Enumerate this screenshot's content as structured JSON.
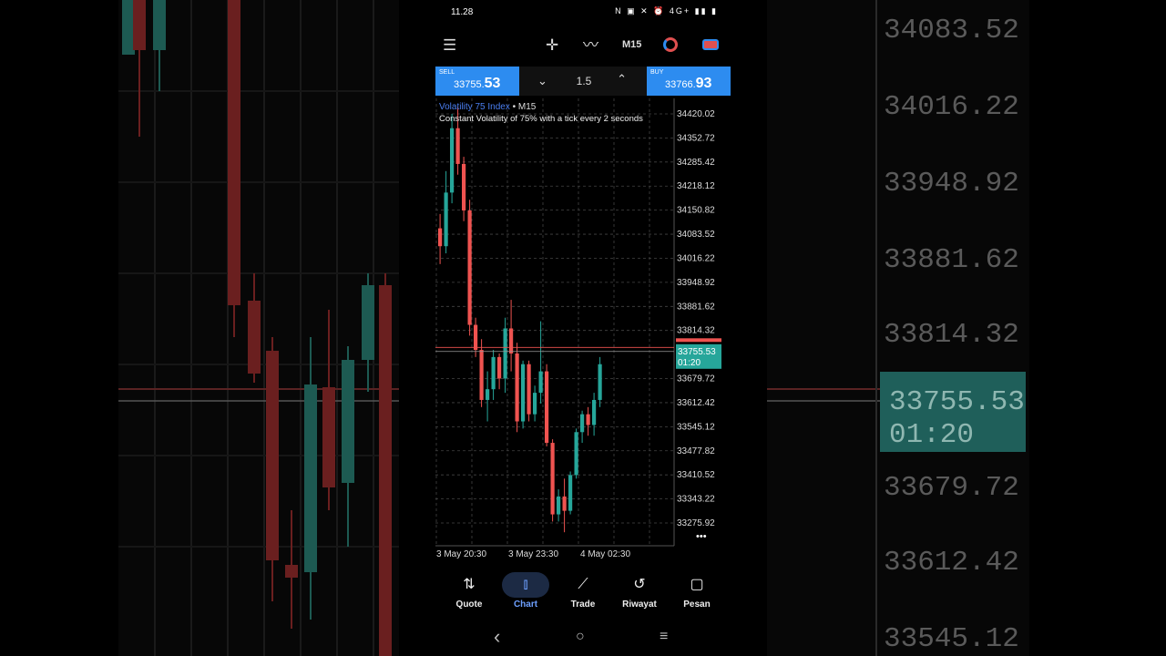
{
  "status": {
    "time": "11.28",
    "icons": "N ▣ ✕ ⏰ 4G+ ▮▮ ▮"
  },
  "toolbar": {
    "timeframe": "M15",
    "icons": [
      "menu-icon",
      "crosshair-icon",
      "indicator-icon",
      "timeframe-clock-icon",
      "toggle-icon"
    ]
  },
  "trade": {
    "sell_label": "SELL",
    "sell_price_main": "33755.",
    "sell_price_big": "53",
    "buy_label": "BUY",
    "buy_price_main": "33766.",
    "buy_price_big": "93",
    "volume": "1.5"
  },
  "chart": {
    "symbol": "Volatility 75 Index",
    "separator": " • ",
    "timeframe": "M15",
    "description": "Constant Volatility of 75% with a tick every 2 seconds",
    "current_price": "33755.53",
    "countdown": "01:20",
    "more": "•••"
  },
  "chart_data": {
    "type": "candlestick",
    "ylim": [
      33243,
      34430
    ],
    "price_ticks": [
      "34420.02",
      "34352.72",
      "34285.42",
      "34218.12",
      "34150.82",
      "34083.52",
      "34016.22",
      "33948.92",
      "33881.62",
      "33814.32",
      "33679.72",
      "33612.42",
      "33545.12",
      "33477.82",
      "33410.52",
      "33343.22",
      "33275.92"
    ],
    "time_labels": [
      "3 May 20:30",
      "3 May 23:30",
      "4 May 02:30"
    ],
    "bid": 33755.53,
    "ask": 33766.93,
    "candles": [
      {
        "o": 34100,
        "h": 34140,
        "l": 34000,
        "c": 34050
      },
      {
        "o": 34050,
        "h": 34260,
        "l": 34030,
        "c": 34200
      },
      {
        "o": 34200,
        "h": 34420,
        "l": 34170,
        "c": 34380
      },
      {
        "o": 34380,
        "h": 34440,
        "l": 34250,
        "c": 34280
      },
      {
        "o": 34280,
        "h": 34300,
        "l": 34120,
        "c": 34150
      },
      {
        "o": 34150,
        "h": 34180,
        "l": 33800,
        "c": 33830
      },
      {
        "o": 33830,
        "h": 33850,
        "l": 33740,
        "c": 33760
      },
      {
        "o": 33760,
        "h": 33790,
        "l": 33600,
        "c": 33620
      },
      {
        "o": 33620,
        "h": 33700,
        "l": 33560,
        "c": 33650
      },
      {
        "o": 33650,
        "h": 33760,
        "l": 33620,
        "c": 33740
      },
      {
        "o": 33740,
        "h": 33750,
        "l": 33650,
        "c": 33680
      },
      {
        "o": 33680,
        "h": 33850,
        "l": 33640,
        "c": 33820
      },
      {
        "o": 33820,
        "h": 33900,
        "l": 33700,
        "c": 33750
      },
      {
        "o": 33750,
        "h": 33780,
        "l": 33530,
        "c": 33560
      },
      {
        "o": 33560,
        "h": 33730,
        "l": 33540,
        "c": 33720
      },
      {
        "o": 33720,
        "h": 33730,
        "l": 33560,
        "c": 33580
      },
      {
        "o": 33580,
        "h": 33660,
        "l": 33560,
        "c": 33640
      },
      {
        "o": 33640,
        "h": 33840,
        "l": 33610,
        "c": 33700
      },
      {
        "o": 33700,
        "h": 33720,
        "l": 33490,
        "c": 33500
      },
      {
        "o": 33500,
        "h": 33510,
        "l": 33280,
        "c": 33300
      },
      {
        "o": 33300,
        "h": 33370,
        "l": 33280,
        "c": 33350
      },
      {
        "o": 33350,
        "h": 33400,
        "l": 33250,
        "c": 33310
      },
      {
        "o": 33310,
        "h": 33420,
        "l": 33300,
        "c": 33410
      },
      {
        "o": 33410,
        "h": 33540,
        "l": 33400,
        "c": 33530
      },
      {
        "o": 33530,
        "h": 33590,
        "l": 33500,
        "c": 33580
      },
      {
        "o": 33580,
        "h": 33600,
        "l": 33520,
        "c": 33550
      },
      {
        "o": 33550,
        "h": 33640,
        "l": 33520,
        "c": 33620
      },
      {
        "o": 33620,
        "h": 33740,
        "l": 33600,
        "c": 33720
      }
    ]
  },
  "bottom_nav": [
    {
      "label": "Quote",
      "icon": "quote-arrows-icon",
      "glyph": "⇅"
    },
    {
      "label": "Chart",
      "icon": "candles-icon",
      "glyph": "⫾"
    },
    {
      "label": "Trade",
      "icon": "trade-line-icon",
      "glyph": "⟋"
    },
    {
      "label": "Riwayat",
      "icon": "history-icon",
      "glyph": "↺"
    },
    {
      "label": "Pesan",
      "icon": "messages-icon",
      "glyph": "▢"
    }
  ],
  "system_nav": {
    "back": "‹",
    "home": "○",
    "recents": "≡"
  },
  "background": {
    "labels": [
      "34083.52",
      "34016.22",
      "33948.92",
      "33881.62",
      "33814.32",
      "33755.53",
      "01:20",
      "33679.72",
      "33612.42",
      "33545.12"
    ]
  },
  "colors": {
    "bull": "#26a69a",
    "bear": "#ef5350",
    "accent": "#2d8cf0"
  }
}
